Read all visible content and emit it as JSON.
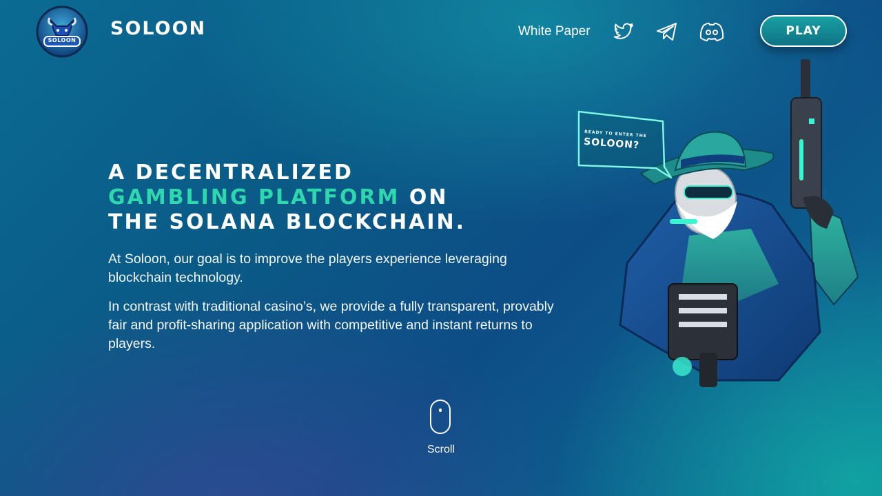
{
  "header": {
    "brand_name": "SOLOON",
    "logo_text": "SOLOON",
    "nav": {
      "white_paper": "White Paper"
    },
    "social_icons": [
      "twitter-icon",
      "telegram-icon",
      "discord-icon"
    ],
    "play_label": "PLAY"
  },
  "hero": {
    "title_line1": "A DECENTRALIZED",
    "title_accent": "GAMBLING PLATFORM",
    "title_after_accent": "ON",
    "title_line3": "THE SOLANA BLOCKCHAIN.",
    "paragraph1": "At Soloon, our goal is to improve the players experience leveraging blockchain technology.",
    "paragraph2": "In contrast with traditional casino’s, we provide a fully transparent, provably fair and profit-sharing application with competitive and instant returns to players."
  },
  "mascot": {
    "bubble_small": "READY TO ENTER THE",
    "bubble_big": "SOLOON?"
  },
  "scroll": {
    "label": "Scroll"
  },
  "colors": {
    "accent": "#2ed7ae",
    "background_deep": "#0a5a86",
    "background_teal": "#14beaa",
    "button": "#19a0a3"
  }
}
